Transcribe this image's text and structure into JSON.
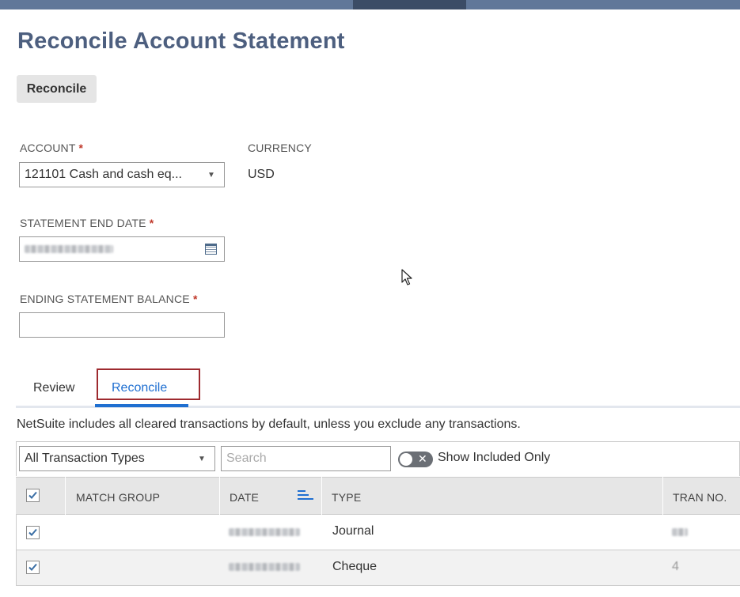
{
  "page": {
    "title": "Reconcile Account Statement"
  },
  "actions": {
    "reconcile_button": "Reconcile"
  },
  "form": {
    "account": {
      "label": "ACCOUNT",
      "required_marker": "*",
      "value": "121101 Cash and cash eq..."
    },
    "currency": {
      "label": "CURRENCY",
      "value": "USD"
    },
    "statement_end_date": {
      "label": "STATEMENT END DATE",
      "required_marker": "*"
    },
    "ending_balance": {
      "label": "ENDING STATEMENT BALANCE",
      "required_marker": "*",
      "value": ""
    }
  },
  "tabs": [
    {
      "label": "Review",
      "active": false
    },
    {
      "label": "Reconcile",
      "active": true
    }
  ],
  "info_text": "NetSuite includes all cleared transactions by default, unless you exclude any transactions.",
  "filters": {
    "transaction_type": "All Transaction Types",
    "search_placeholder": "Search",
    "show_included_only": "Show Included Only"
  },
  "grid": {
    "columns": [
      "MATCH GROUP",
      "DATE",
      "TYPE",
      "TRAN NO."
    ],
    "rows": [
      {
        "checked": true,
        "type": "Journal"
      },
      {
        "checked": true,
        "type": "Cheque",
        "tran_no": "4"
      }
    ]
  },
  "icons": [
    "dropdown-caret-icon",
    "calendar-icon",
    "checkmark-icon",
    "sort-icon",
    "toggle-x-icon",
    "mouse-cursor-icon"
  ],
  "colors": {
    "title": "#4d5f7f",
    "accent": "#1f6fd1",
    "tab_highlight_border": "#9e2a2f",
    "topbar": "#607799"
  }
}
